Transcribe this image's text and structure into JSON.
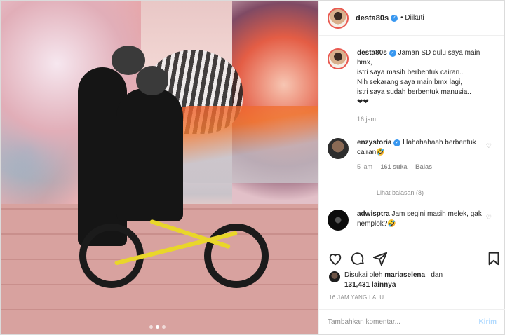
{
  "post": {
    "username": "desta80s",
    "follow_status": "• Diikuti",
    "caption_lines": [
      "Jaman SD dulu saya main",
      "bmx,",
      "istri saya masih berbentuk cairan..",
      "Nih sekarang saya main bmx lagi,",
      "istri saya sudah berbentuk manusia..",
      "❤❤"
    ],
    "caption_time": "16 jam"
  },
  "comments": [
    {
      "username": "enzystoria",
      "verified": true,
      "text": "Hahahahaah berbentuk cairan🤣",
      "time": "5 jam",
      "likes": "161 suka",
      "reply": "Balas",
      "view_replies": "Lihat balasan (8)"
    },
    {
      "username": "adwisptra",
      "verified": false,
      "text": "Jam segini masih melek, gak nemplok?🤣"
    }
  ],
  "likes_line1_prefix": "Disukai oleh ",
  "likes_user": "mariaselena_",
  "likes_line1_suffix": " dan",
  "likes_count": "131,431",
  "likes_line2_suffix": " lainnya",
  "time_ago": "16 JAM YANG LALU",
  "comment_input": {
    "placeholder": "Tambahkan komentar...",
    "post_label": "Kirim"
  },
  "colors": {
    "verified": "#3897f0",
    "post_button": "#b3dbff",
    "avatar_ring": "#e95950"
  },
  "carousel": {
    "count": 3,
    "active_index": 1
  }
}
